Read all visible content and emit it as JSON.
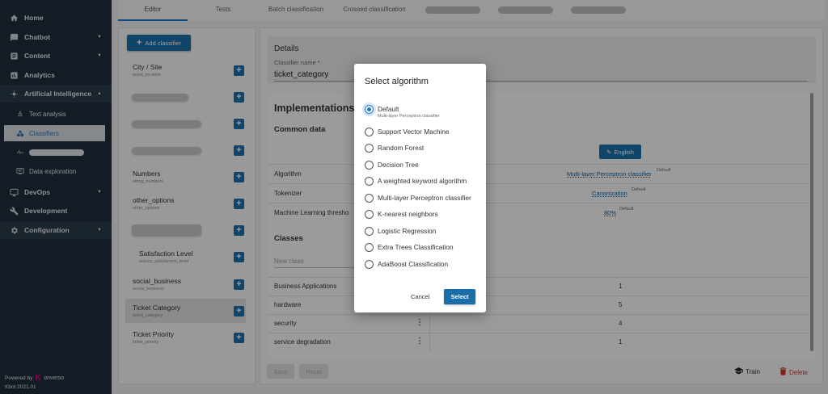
{
  "sidebar": {
    "items": [
      {
        "label": "Home",
        "icon": "home-icon"
      },
      {
        "label": "Chatbot",
        "icon": "chat-icon"
      },
      {
        "label": "Content",
        "icon": "content-icon"
      },
      {
        "label": "Analytics",
        "icon": "analytics-icon"
      },
      {
        "label": "Artificial Intelligence",
        "icon": "ai-icon"
      },
      {
        "label": "DevOps",
        "icon": "devops-icon"
      },
      {
        "label": "Development",
        "icon": "wrench-icon"
      },
      {
        "label": "Configuration",
        "icon": "gear-icon"
      }
    ],
    "sub_items": [
      {
        "label": "Text analysis",
        "icon": "text-analysis-icon"
      },
      {
        "label": "Classifiers",
        "icon": "classifiers-icon"
      },
      {
        "label": "",
        "icon": "flow-icon"
      },
      {
        "label": "Data exploration",
        "icon": "data-exploration-icon"
      }
    ],
    "powered_by": "Powered by",
    "brand": "onverso",
    "brand_k": "K",
    "version": "Kbot 2021.01"
  },
  "tabs": [
    "Editor",
    "Tests",
    "Batch classification",
    "Crossed classification"
  ],
  "classifier_list": {
    "add_label": "Add classifier",
    "items": [
      {
        "name": "City / Site",
        "key": "ticket_location"
      },
      {
        "name": "",
        "key": ""
      },
      {
        "name": "",
        "key": ""
      },
      {
        "name": "",
        "key": ""
      },
      {
        "name": "Numbers",
        "key": "string_numbers"
      },
      {
        "name": "other_options",
        "key": "other_options"
      },
      {
        "name": "",
        "key": ""
      },
      {
        "name": "Satisfaction Level",
        "key": "survey_satisfaction_level"
      },
      {
        "name": "social_business",
        "key": "social_business"
      },
      {
        "name": "Ticket Category",
        "key": "ticket_category"
      },
      {
        "name": "Ticket Priority",
        "key": "ticket_priority"
      }
    ]
  },
  "details": {
    "title": "Details",
    "field_label": "Classifier name *",
    "field_value": "ticket_category"
  },
  "implementations": {
    "title": "Implementations",
    "common_data": "Common data",
    "language_button": "English",
    "rows": [
      {
        "label": "Algorithm",
        "value": "Multi-layer Perceptron classifier",
        "default": "Default"
      },
      {
        "label": "Tokenizer",
        "value": "Canonization",
        "default": "Default"
      },
      {
        "label": "Machine Learning thresho",
        "value": "80%",
        "default": "Default"
      }
    ],
    "classes_title": "Classes",
    "new_class_placeholder": "New class",
    "classes": [
      {
        "name": "Business Applications",
        "count": "1"
      },
      {
        "name": "hardware",
        "count": "5"
      },
      {
        "name": "security",
        "count": "4"
      },
      {
        "name": "service degradation",
        "count": "1"
      }
    ],
    "save_label": "Save",
    "reset_label": "Reset",
    "train_label": "Train",
    "delete_label": "Delete"
  },
  "dialog": {
    "title": "Select algorithm",
    "selected_index": 0,
    "options": [
      {
        "label": "Default",
        "sub": "Multi-layer Perceptron classifier"
      },
      {
        "label": "Support Vector Machine"
      },
      {
        "label": "Random Forest"
      },
      {
        "label": "Decision Tree"
      },
      {
        "label": "A weighted keyword algorithm"
      },
      {
        "label": "Multi-layer Perceptron classifier"
      },
      {
        "label": "K-nearest neighbors"
      },
      {
        "label": "Logistic Regression"
      },
      {
        "label": "Extra Trees Classification"
      },
      {
        "label": "AdaBoost Classification"
      }
    ],
    "cancel_label": "Cancel",
    "select_label": "Select"
  },
  "colors": {
    "sidebar_bg": "#1f2d3a",
    "accent": "#1b6fa8",
    "radio_selected": "#1976d2",
    "delete": "#d32f2f",
    "brand_magenta": "#e4007f"
  }
}
